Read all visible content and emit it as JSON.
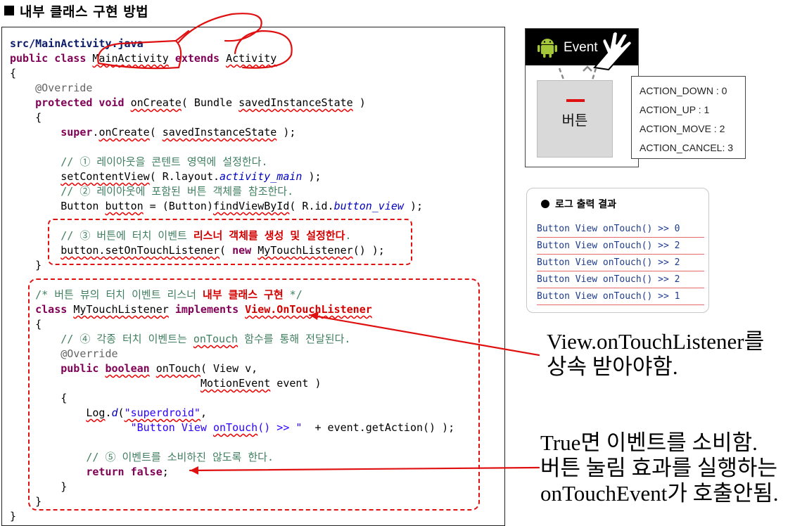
{
  "heading": "내부 클래스 구현 방법",
  "code_lines": [
    {
      "parts": [
        {
          "t": "src/MainActivity.java",
          "c": "navy"
        }
      ]
    },
    {
      "parts": [
        {
          "t": "public class ",
          "c": "kw"
        },
        {
          "t": "MainActivity",
          "c": "ul"
        },
        {
          "t": " "
        },
        {
          "t": "extends",
          "c": "kw"
        },
        {
          "t": " "
        },
        {
          "t": "Activity",
          "c": "ul"
        }
      ]
    },
    {
      "parts": [
        {
          "t": "{"
        }
      ]
    },
    {
      "parts": [
        {
          "t": "    @Override",
          "c": "ann"
        }
      ]
    },
    {
      "parts": [
        {
          "t": "    "
        },
        {
          "t": "protected void",
          "c": "kw"
        },
        {
          "t": " "
        },
        {
          "t": "onCreate",
          "c": "ul"
        },
        {
          "t": "( Bundle "
        },
        {
          "t": "savedInstanceState",
          "c": "ul"
        },
        {
          "t": " )"
        }
      ]
    },
    {
      "parts": [
        {
          "t": "    {"
        }
      ]
    },
    {
      "parts": [
        {
          "t": "        "
        },
        {
          "t": "super",
          "c": "kw"
        },
        {
          "t": "."
        },
        {
          "t": "onCreate",
          "c": "ul"
        },
        {
          "t": "( "
        },
        {
          "t": "savedInstanceState",
          "c": "ul"
        },
        {
          "t": " );"
        }
      ]
    },
    {
      "parts": [
        {
          "t": ""
        }
      ]
    },
    {
      "parts": [
        {
          "t": "        // ① 레이아웃을 콘텐트 영역에 설정한다.",
          "c": "cm"
        }
      ]
    },
    {
      "parts": [
        {
          "t": "        "
        },
        {
          "t": "setContentView",
          "c": "ul"
        },
        {
          "t": "( R.layout."
        },
        {
          "t": "activity_main",
          "c": "fld"
        },
        {
          "t": " );"
        }
      ]
    },
    {
      "parts": [
        {
          "t": "        // ② 레이아웃에 포함된 버튼 객체를 참조한다.",
          "c": "cm"
        }
      ]
    },
    {
      "parts": [
        {
          "t": "        Button "
        },
        {
          "t": "button",
          "c": "ul"
        },
        {
          "t": " = (Button)"
        },
        {
          "t": "findViewById",
          "c": "ul"
        },
        {
          "t": "( R.id."
        },
        {
          "t": "button_view",
          "c": "fld"
        },
        {
          "t": " );"
        }
      ]
    },
    {
      "parts": [
        {
          "t": ""
        }
      ]
    },
    {
      "parts": [
        {
          "t": "        // ③ 버튼에 터치 이벤트 ",
          "c": "cm"
        },
        {
          "t": "리스너 객체를 생성 및 설정한다",
          "c": "red"
        },
        {
          "t": ".",
          "c": "cm"
        }
      ]
    },
    {
      "parts": [
        {
          "t": "        "
        },
        {
          "t": "button.setOnTouchListener",
          "c": "ul"
        },
        {
          "t": "( "
        },
        {
          "t": "new",
          "c": "kw"
        },
        {
          "t": " "
        },
        {
          "t": "MyTouchListener",
          "c": "ul"
        },
        {
          "t": "() );"
        }
      ]
    },
    {
      "parts": [
        {
          "t": "    }"
        }
      ]
    },
    {
      "parts": [
        {
          "t": ""
        }
      ]
    },
    {
      "parts": [
        {
          "t": "    /* 버튼 뷰의 터치 이벤트 리스너 ",
          "c": "cm"
        },
        {
          "t": "내부 클래스 구현",
          "c": "red"
        },
        {
          "t": " */",
          "c": "cm"
        }
      ]
    },
    {
      "parts": [
        {
          "t": "    "
        },
        {
          "t": "class",
          "c": "kw"
        },
        {
          "t": " "
        },
        {
          "t": "MyTouchListener",
          "c": "ul"
        },
        {
          "t": " "
        },
        {
          "t": "implements",
          "c": "kw"
        },
        {
          "t": " "
        },
        {
          "t": "View.OnTouchListener",
          "c": "red ul"
        }
      ]
    },
    {
      "parts": [
        {
          "t": "    {"
        }
      ]
    },
    {
      "parts": [
        {
          "t": "        // ④ 각종 터치 이벤트는 ",
          "c": "cm"
        },
        {
          "t": "onTouch",
          "c": "cm ul"
        },
        {
          "t": " 함수를 통해 전달된다.",
          "c": "cm"
        }
      ]
    },
    {
      "parts": [
        {
          "t": "        @Override",
          "c": "ann"
        }
      ]
    },
    {
      "parts": [
        {
          "t": "        "
        },
        {
          "t": "public",
          "c": "kw"
        },
        {
          "t": " "
        },
        {
          "t": "boolean",
          "c": "kw ul"
        },
        {
          "t": " "
        },
        {
          "t": "onTouch",
          "c": "ul"
        },
        {
          "t": "( View v,"
        }
      ]
    },
    {
      "parts": [
        {
          "t": "                              "
        },
        {
          "t": "MotionEvent",
          "c": "ul"
        },
        {
          "t": " event )"
        }
      ]
    },
    {
      "parts": [
        {
          "t": "        {"
        }
      ]
    },
    {
      "parts": [
        {
          "t": "            "
        },
        {
          "t": "Log",
          "c": "ul"
        },
        {
          "t": "."
        },
        {
          "t": "d",
          "c": "fld"
        },
        {
          "t": "("
        },
        {
          "t": "\"superdroid\"",
          "c": "str ul"
        },
        {
          "t": ","
        }
      ]
    },
    {
      "parts": [
        {
          "t": "                   "
        },
        {
          "t": "\"Button View ",
          "c": "str"
        },
        {
          "t": "onTouch",
          "c": "str ul"
        },
        {
          "t": "() >> \"",
          "c": "str"
        },
        {
          "t": "  + event.getAction() );"
        }
      ]
    },
    {
      "parts": [
        {
          "t": ""
        }
      ]
    },
    {
      "parts": [
        {
          "t": "            // ⑤ 이벤트를 소비하진 않도록 한다.",
          "c": "cm"
        }
      ]
    },
    {
      "parts": [
        {
          "t": "            "
        },
        {
          "t": "return false",
          "c": "kw"
        },
        {
          "t": ";"
        }
      ]
    },
    {
      "parts": [
        {
          "t": "        }"
        }
      ]
    },
    {
      "parts": [
        {
          "t": "    }"
        }
      ]
    },
    {
      "parts": [
        {
          "t": "}"
        }
      ]
    }
  ],
  "emulator": {
    "title": "Event",
    "button_label": "버튼",
    "colors": {
      "bar": "#000000",
      "button": "#d9d9d9",
      "press_marker": "#e01010"
    }
  },
  "actions": [
    "ACTION_DOWN : 0",
    "ACTION_UP : 1",
    "ACTION_MOVE : 2",
    "ACTION_CANCEL: 3"
  ],
  "log": {
    "title": "로그 출력 결과",
    "lines": [
      "Button View onTouch() >> 0",
      "Button View onTouch() >> 2",
      "Button View onTouch() >> 2",
      "Button View onTouch() >> 2",
      "Button View onTouch() >> 1"
    ]
  },
  "note1": [
    "View.onTouchListener를",
    "상속 받아야함."
  ],
  "note2": [
    "True면 이벤트를 소비함.",
    "버튼 눌림 효과를 실행하는",
    "onTouchEvent가 호출안됨."
  ],
  "icons": [
    "android-icon",
    "hand-touch-icon"
  ],
  "colors": {
    "accent_red": "#e01010"
  }
}
